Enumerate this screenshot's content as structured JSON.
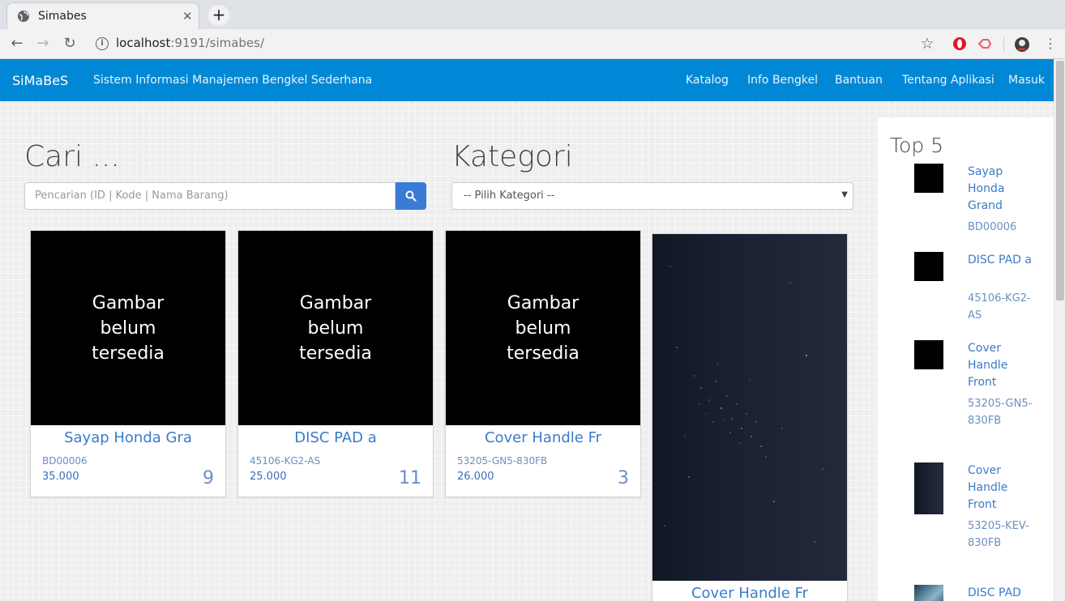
{
  "browser": {
    "tab_title": "Simabes",
    "url_host": "localhost",
    "url_rest": ":9191/simabes/"
  },
  "navbar": {
    "brand": "SiMaBeS",
    "tagline": "Sistem Informasi Manajemen Bengkel Sederhana",
    "links": [
      "Katalog",
      "Info Bengkel",
      "Bantuan",
      "Tentang Aplikasi",
      "Masuk"
    ],
    "color": "#0088d6"
  },
  "search": {
    "heading": "Cari ...",
    "placeholder": "Pencarian (ID | Kode | Nama Barang)",
    "button_icon": "search-icon"
  },
  "category": {
    "heading": "Kategori",
    "selected": "-- Pilih Kategori --"
  },
  "products": [
    {
      "image_text": "Gambar belum tersedia",
      "title": "Sayap Honda Gra",
      "code": "BD00006",
      "price": "35.000",
      "stock": "9"
    },
    {
      "image_text": "Gambar belum tersedia",
      "title": "DISC PAD a",
      "code": "45106-KG2-AS",
      "price": "25.000",
      "stock": "11"
    },
    {
      "image_text": "Gambar belum tersedia",
      "title": "Cover Handle Fr",
      "code": "53205-GN5-830FB",
      "price": "26.000",
      "stock": "3"
    },
    {
      "image_text": "",
      "title": "Cover Handle Fr",
      "code": "",
      "price": "",
      "stock": ""
    }
  ],
  "top5": {
    "heading": "Top 5",
    "items": [
      {
        "name": "Sayap Honda Grand",
        "code": "BD00006"
      },
      {
        "name": "DISC PAD a",
        "code": "45106-KG2-AS"
      },
      {
        "name": "Cover Handle Front",
        "code": "53205-GN5-830FB"
      },
      {
        "name": "Cover Handle Front",
        "code": "53205-KEV-830FB"
      },
      {
        "name": "DISC PAD",
        "code": ""
      }
    ]
  }
}
